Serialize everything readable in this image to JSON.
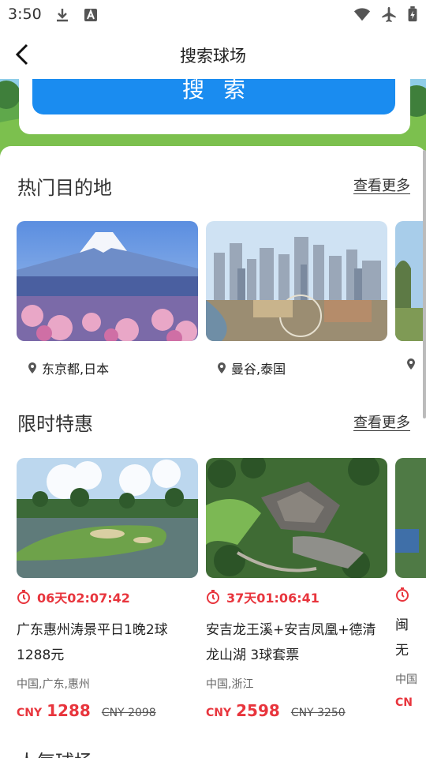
{
  "status_bar": {
    "time": "3:50",
    "icons_left": [
      "download-icon",
      "font-icon"
    ],
    "icons_right": [
      "wifi-icon",
      "airplane-icon",
      "battery-icon"
    ]
  },
  "nav": {
    "title": "搜索球场",
    "back_icon": "chevron-left-icon"
  },
  "search": {
    "button_label": "搜索"
  },
  "hot_destinations": {
    "title": "热门目的地",
    "more_label": "查看更多",
    "items": [
      {
        "label": "东京都,日本"
      },
      {
        "label": "曼谷,泰国"
      },
      {
        "label": ""
      }
    ]
  },
  "deals": {
    "title": "限时特惠",
    "more_label": "查看更多",
    "items": [
      {
        "timer": "06天02:07:42",
        "title": "广东惠州涛景平日1晚2球1288元",
        "location": "中国,广东,惠州",
        "currency": "CNY",
        "price": "1288",
        "original": "CNY 2098"
      },
      {
        "timer": "37天01:06:41",
        "title": "安吉龙王溪+安吉凤凰+德清龙山湖 3球套票",
        "location": "中国,浙江",
        "currency": "CNY",
        "price": "2598",
        "original": "CNY 3250"
      },
      {
        "timer": "",
        "title": "闽无",
        "location": "中国",
        "currency": "CN",
        "price": "",
        "original": ""
      }
    ]
  },
  "popular_courses": {
    "title": "人气球场"
  },
  "colors": {
    "accent": "#1a8cf0",
    "price_red": "#e8353d"
  }
}
